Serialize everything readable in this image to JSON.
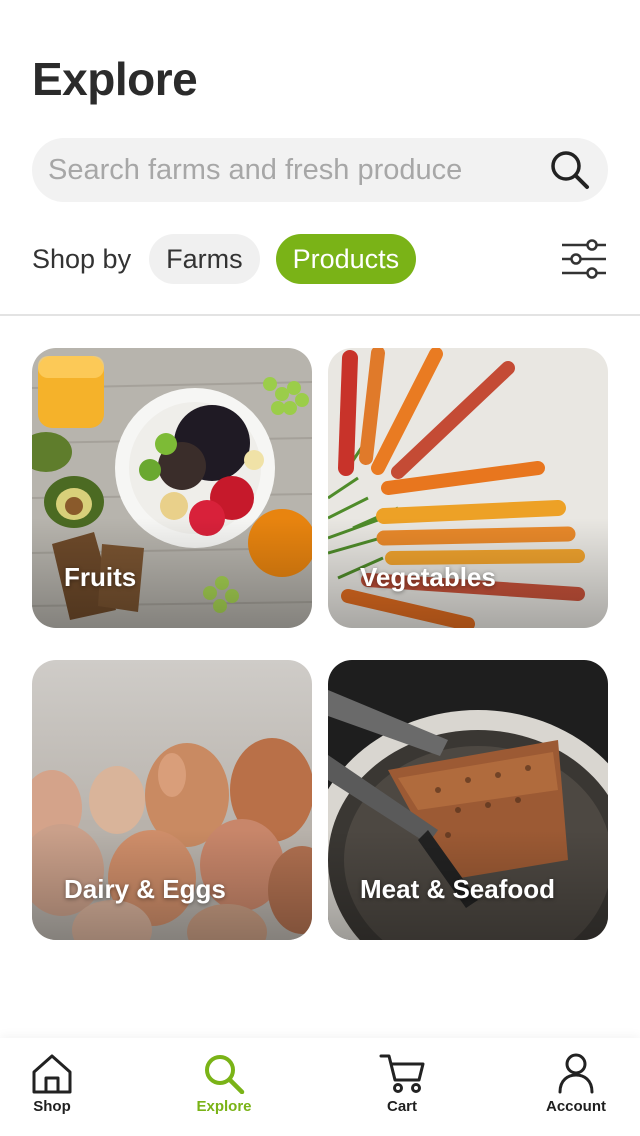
{
  "header": {
    "title": "Explore"
  },
  "search": {
    "placeholder": "Search farms and fresh produce",
    "value": "",
    "icon": "search-icon"
  },
  "shop_by": {
    "label": "Shop by",
    "options": [
      {
        "label": "Farms",
        "selected": false
      },
      {
        "label": "Products",
        "selected": true
      }
    ],
    "filter_icon": "sliders-icon"
  },
  "categories": [
    {
      "label": "Fruits"
    },
    {
      "label": "Vegetables"
    },
    {
      "label": "Dairy & Eggs"
    },
    {
      "label": "Meat & Seafood"
    }
  ],
  "tabbar": {
    "items": [
      {
        "label": "Shop",
        "icon": "home-icon",
        "active": false
      },
      {
        "label": "Explore",
        "icon": "search-icon",
        "active": true
      },
      {
        "label": "Cart",
        "icon": "cart-icon",
        "active": false
      },
      {
        "label": "Account",
        "icon": "person-icon",
        "active": false
      }
    ]
  },
  "colors": {
    "accent": "#7ab317",
    "chip_inactive": "#f0f0f0",
    "search_bg": "#f2f2f2"
  }
}
